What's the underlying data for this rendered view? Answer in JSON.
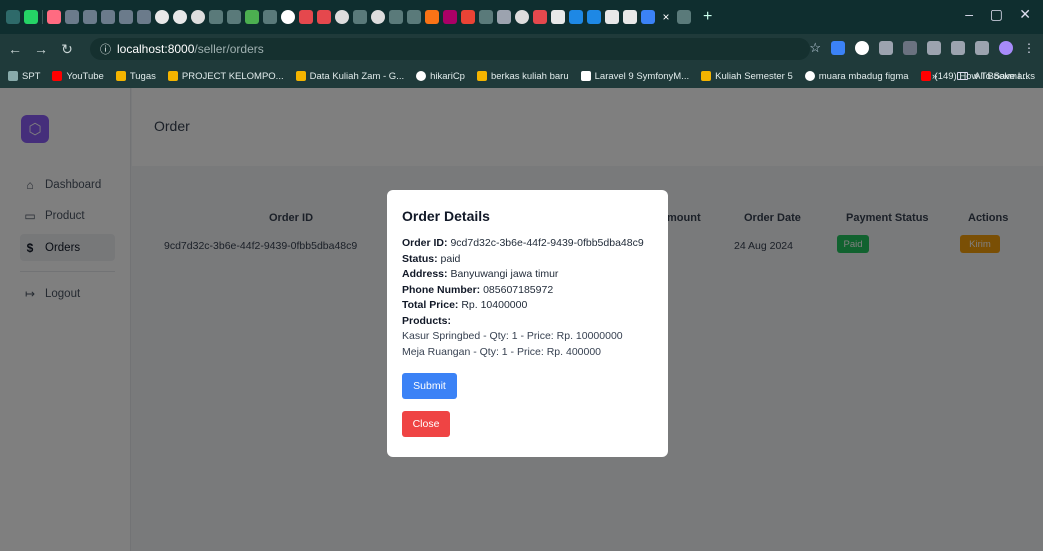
{
  "browser": {
    "url_host": "localhost:8000",
    "url_path": "/seller/orders",
    "bookmarks": [
      "SPT",
      "YouTube",
      "Tugas",
      "PROJECT KELOMPO...",
      "Data Kuliah Zam - G...",
      "hikariCp",
      "berkas kuliah baru",
      "Laravel 9 SymfonyM...",
      "Kuliah Semester 5",
      "muara mbadug figma",
      "(149) How To Save I..."
    ],
    "bookmarks_overflow": "»",
    "all_bookmarks": "All Bookmarks",
    "new_tab": "+",
    "close_tab": "×",
    "minimize": "–",
    "restore": "▢",
    "close": "✕"
  },
  "sidebar": {
    "items": [
      {
        "label": "Dashboard",
        "icon": "home-icon"
      },
      {
        "label": "Product",
        "icon": "box-icon"
      },
      {
        "label": "Orders",
        "icon": "dollar-icon"
      },
      {
        "label": "Logout",
        "icon": "logout-icon"
      }
    ]
  },
  "header": {
    "title": "Order"
  },
  "table": {
    "headers": [
      "Order ID",
      "mount",
      "Order Date",
      "Payment Status",
      "Actions"
    ],
    "row": {
      "order_id": "9cd7d32c-3b6e-44f2-9439-0fbb5dba48c9",
      "order_date": "24 Aug 2024",
      "payment_status": "Paid",
      "action": "Kirim"
    }
  },
  "modal": {
    "title": "Order Details",
    "order_id_label": "Order ID:",
    "order_id": "9cd7d32c-3b6e-44f2-9439-0fbb5dba48c9",
    "status_label": "Status:",
    "status": "paid",
    "address_label": "Address:",
    "address": "Banyuwangi jawa timur",
    "phone_label": "Phone Number:",
    "phone": "085607185972",
    "total_label": "Total Price:",
    "total": "Rp. 10400000",
    "products_label": "Products:",
    "products": [
      "Kasur Springbed - Qty: 1 - Price: Rp. 10000000",
      "Meja Ruangan - Qty: 1 - Price: Rp. 400000"
    ],
    "submit_label": "Submit",
    "close_label": "Close"
  }
}
